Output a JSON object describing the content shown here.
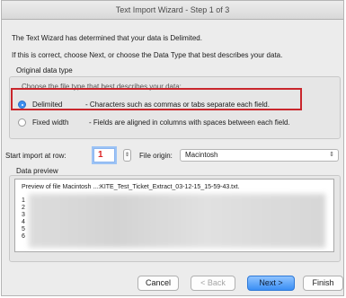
{
  "window": {
    "title": "Text Import Wizard - Step 1 of 3"
  },
  "intro": {
    "line1": "The Text Wizard has determined that your data is Delimited.",
    "line2": "If this is correct, choose Next, or choose the Data Type that best describes your data."
  },
  "data_type": {
    "group_label": "Original data type",
    "hint": "Choose the file type that best describes your data:",
    "options": [
      {
        "label": "Delimited",
        "desc": "- Characters such as commas or tabs separate each field.",
        "selected": true
      },
      {
        "label": "Fixed width",
        "desc": "- Fields are aligned in columns with spaces between each field.",
        "selected": false
      }
    ]
  },
  "import": {
    "start_row_label": "Start import at row:",
    "start_row_value": "1",
    "origin_label": "File origin:",
    "origin_value": "Macintosh"
  },
  "preview": {
    "group_label": "Data preview",
    "header": "Preview of file Macintosh ...:KITE_Test_Ticket_Extract_03-12-15_15-59-43.txt.",
    "row_numbers": [
      "1",
      "2",
      "3",
      "4",
      "5",
      "6"
    ]
  },
  "buttons": {
    "cancel": "Cancel",
    "back": "< Back",
    "next": "Next >",
    "finish": "Finish"
  },
  "colors": {
    "highlight": "#c9262c",
    "accent": "#3a8ef5"
  }
}
